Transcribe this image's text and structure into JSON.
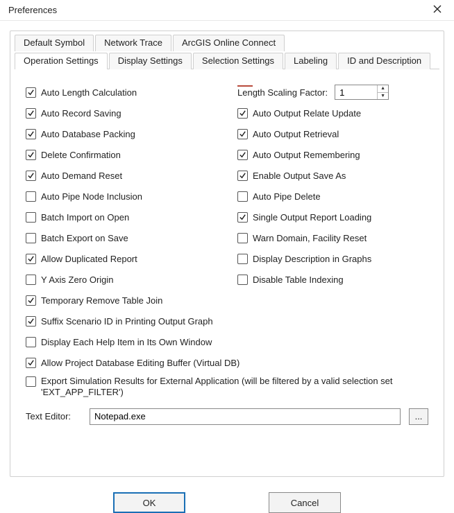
{
  "title": "Preferences",
  "tabs_row1": [
    {
      "label": "Default Symbol"
    },
    {
      "label": "Network Trace"
    },
    {
      "label": "ArcGIS Online Connect"
    }
  ],
  "tabs_row2": [
    {
      "label": "Operation Settings",
      "active": true
    },
    {
      "label": "Display Settings"
    },
    {
      "label": "Selection Settings"
    },
    {
      "label": "Labeling"
    },
    {
      "label": "ID and Description"
    }
  ],
  "left_checks": [
    {
      "label": "Auto Length Calculation",
      "checked": true
    },
    {
      "label": "Auto Record Saving",
      "checked": true
    },
    {
      "label": "Auto Database Packing",
      "checked": true
    },
    {
      "label": "Delete Confirmation",
      "checked": true
    },
    {
      "label": "Auto Demand Reset",
      "checked": true
    },
    {
      "label": "Auto Pipe Node Inclusion",
      "checked": false
    },
    {
      "label": "Batch Import on Open",
      "checked": false
    },
    {
      "label": "Batch Export on Save",
      "checked": false
    },
    {
      "label": "Allow Duplicated Report",
      "checked": true
    },
    {
      "label": "Y Axis Zero Origin",
      "checked": false
    }
  ],
  "length_factor": {
    "label": "Length Scaling Factor:",
    "value": "1"
  },
  "right_checks": [
    {
      "label": "Auto Output Relate Update",
      "checked": true
    },
    {
      "label": "Auto Output Retrieval",
      "checked": true
    },
    {
      "label": "Auto Output Remembering",
      "checked": true
    },
    {
      "label": "Enable Output Save As",
      "checked": true
    },
    {
      "label": "Auto Pipe Delete",
      "checked": false
    },
    {
      "label": "Single Output Report Loading",
      "checked": true
    },
    {
      "label": "Warn Domain, Facility Reset",
      "checked": false
    },
    {
      "label": "Display Description in Graphs",
      "checked": false
    },
    {
      "label": "Disable Table Indexing",
      "checked": false
    }
  ],
  "full_checks": [
    {
      "label": "Temporary Remove Table Join",
      "checked": true
    },
    {
      "label": "Suffix Scenario ID in Printing Output Graph",
      "checked": true
    },
    {
      "label": "Display Each Help Item in Its Own Window",
      "checked": false
    },
    {
      "label": "Allow Project Database Editing Buffer (Virtual DB)",
      "checked": true
    },
    {
      "label": "Export Simulation Results for External Application (will be filtered by a valid selection set 'EXT_APP_FILTER')",
      "checked": false,
      "multiline": true
    }
  ],
  "text_editor": {
    "label": "Text Editor:",
    "value": "Notepad.exe",
    "browse": "..."
  },
  "buttons": {
    "ok": "OK",
    "cancel": "Cancel"
  }
}
